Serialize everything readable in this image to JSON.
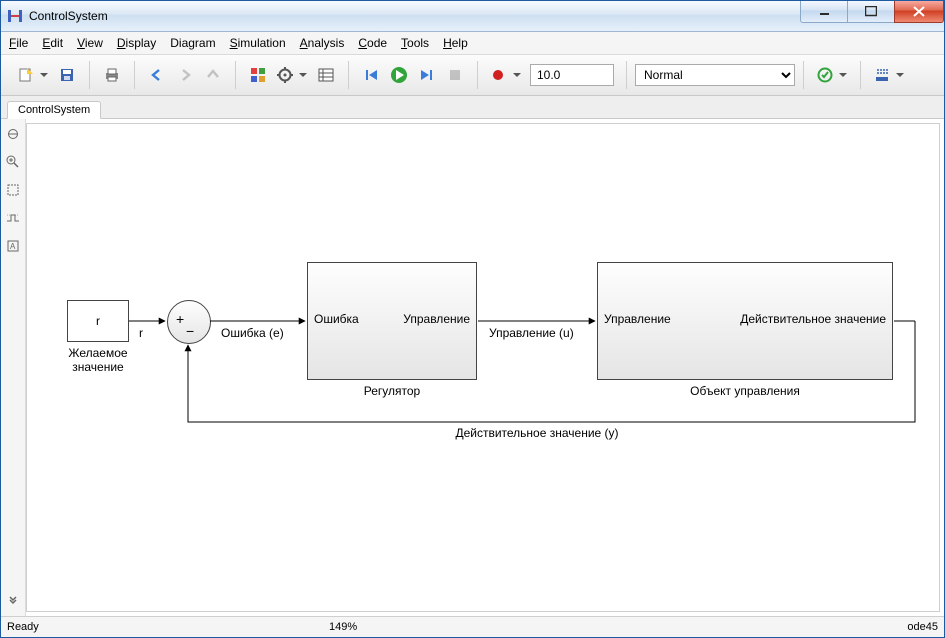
{
  "window": {
    "title": "ControlSystem"
  },
  "menu": {
    "file": "File",
    "edit": "Edit",
    "view": "View",
    "display": "Display",
    "diagram": "Diagram",
    "simulation": "Simulation",
    "analysis": "Analysis",
    "code": "Code",
    "tools": "Tools",
    "help": "Help"
  },
  "toolbar": {
    "stop_time": "10.0",
    "mode": "Normal"
  },
  "tabs": {
    "active": "ControlSystem"
  },
  "diagram": {
    "const_block": {
      "value": "r",
      "name": "Желаемое\nзначение"
    },
    "const_out_signal": "r",
    "sum": {
      "plus": "+",
      "minus": "−"
    },
    "error_signal": "Ошибка (e)",
    "controller": {
      "name": "Регулятор",
      "in_port": "Ошибка",
      "out_port": "Управление"
    },
    "control_signal": "Управление (u)",
    "plant": {
      "name": "Объект управления",
      "in_port": "Управление",
      "out_port": "Действительное значение"
    },
    "feedback_signal": "Действительное значение (y)"
  },
  "status": {
    "ready": "Ready",
    "zoom": "149%",
    "solver": "ode45"
  }
}
